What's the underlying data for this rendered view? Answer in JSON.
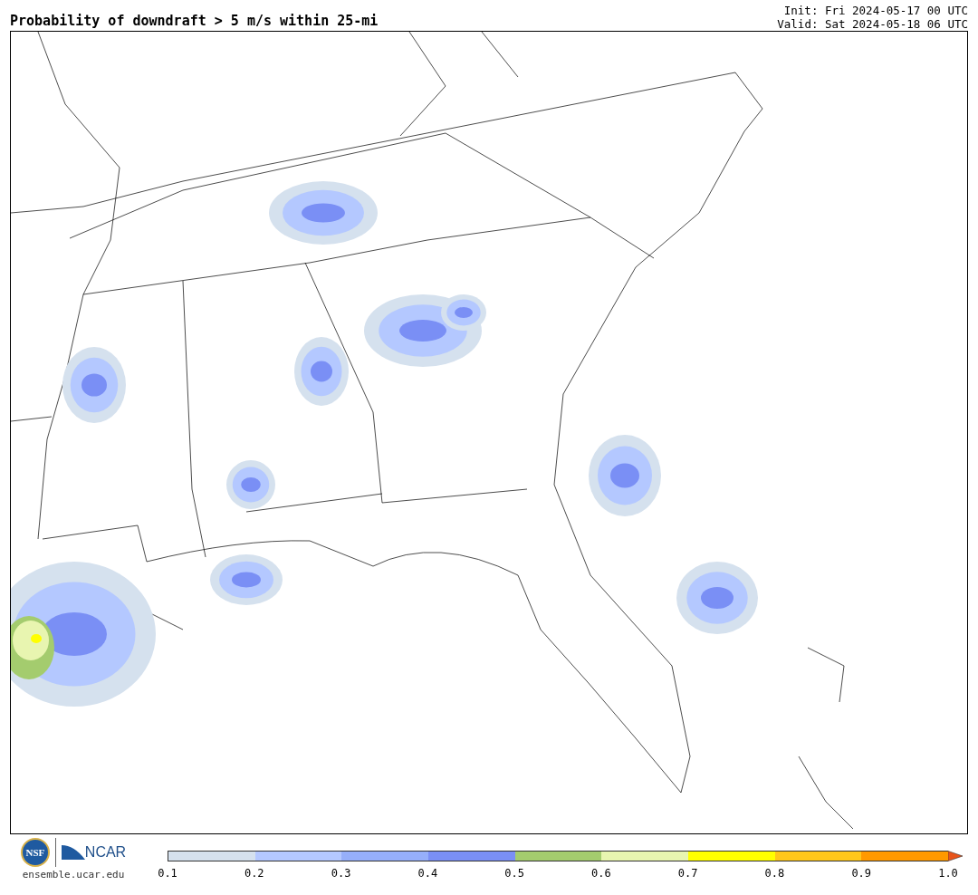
{
  "title": "Probability of downdraft > 5 m/s within 25-mi",
  "init": "Init: Fri 2024-05-17 00 UTC",
  "valid": "Valid: Sat 2024-05-18 06 UTC",
  "footer": {
    "site": "ensemble.ucar.edu",
    "logo_text": "NCAR",
    "seal_text": "NSF"
  },
  "colorbar": {
    "bins": [
      {
        "color": "#d5e1ee"
      },
      {
        "color": "#b4c8ff"
      },
      {
        "color": "#96affa"
      },
      {
        "color": "#7a8ff5"
      },
      {
        "color": "#a4cc6e"
      },
      {
        "color": "#e8f5b0"
      },
      {
        "color": "#ffff00"
      },
      {
        "color": "#ffc71a"
      },
      {
        "color": "#ff9900"
      },
      {
        "color": "#e8541a",
        "kind": "arrow"
      }
    ],
    "ticks": [
      "0.1",
      "0.2",
      "0.3",
      "0.4",
      "0.5",
      "0.6",
      "0.7",
      "0.8",
      "0.9",
      "1.0"
    ]
  }
}
